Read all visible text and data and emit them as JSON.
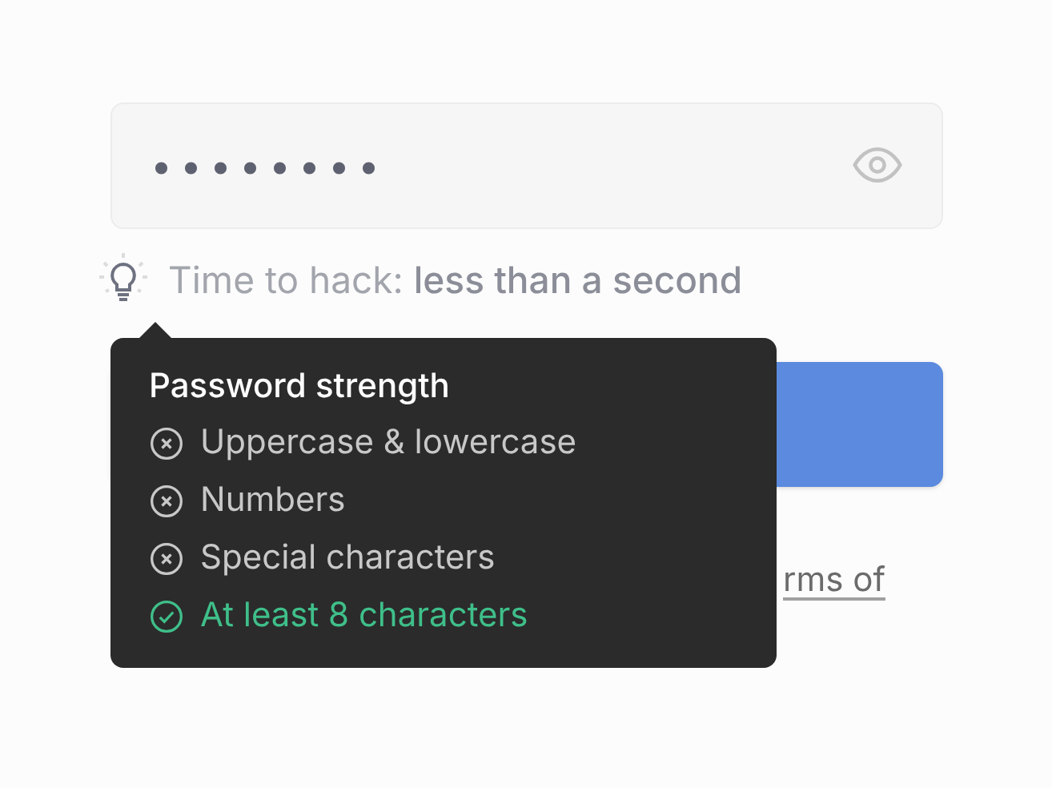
{
  "password_field": {
    "value": "••••••••",
    "revealed": false
  },
  "hint": {
    "label": "Time to hack:",
    "value": "less than a second"
  },
  "tooltip": {
    "title": "Password strength",
    "visible": true,
    "requirements": [
      {
        "label": "Uppercase & lowercase",
        "met": false
      },
      {
        "label": "Numbers",
        "met": false
      },
      {
        "label": "Special characters",
        "met": false
      },
      {
        "label": "At least 8 characters",
        "met": true
      }
    ]
  },
  "legal": {
    "link_fragment": "rms of"
  }
}
